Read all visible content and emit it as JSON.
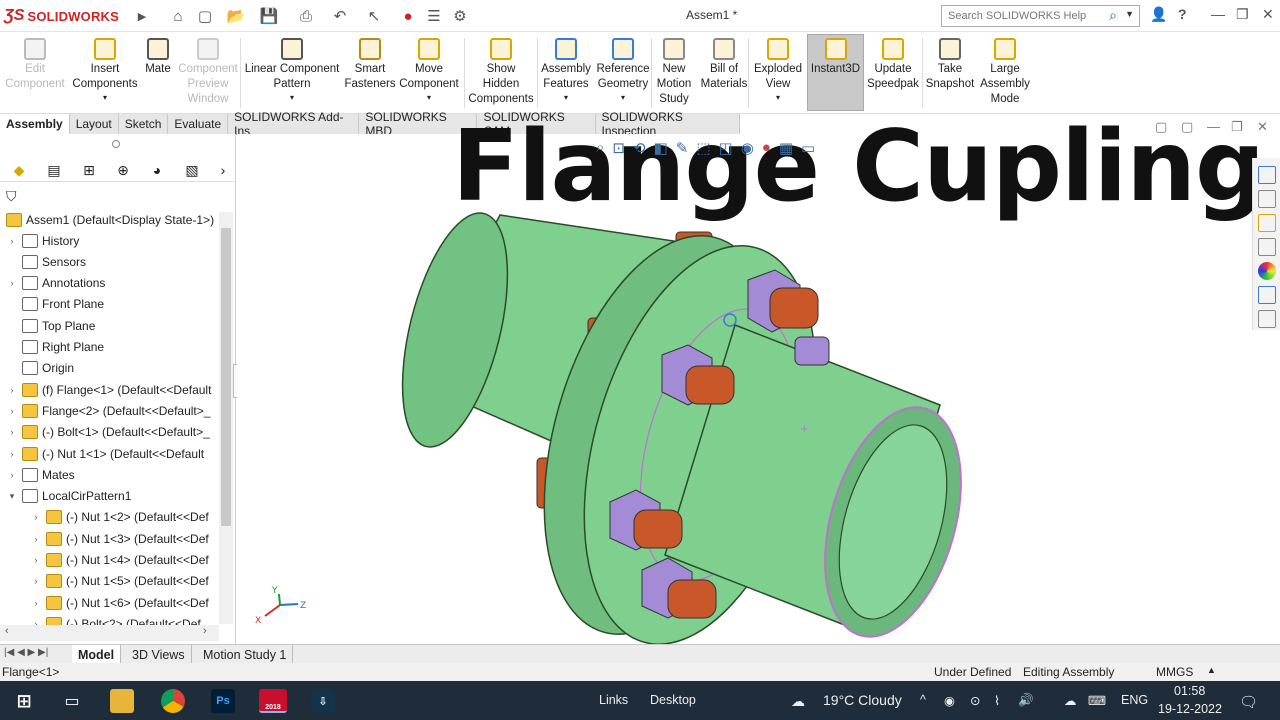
{
  "app": {
    "brand": "SOLIDWORKS",
    "doc_title": "Assem1 *"
  },
  "search": {
    "placeholder": "Search SOLIDWORKS Help"
  },
  "ribbon": {
    "buttons": [
      {
        "label": "Edit\nComponent",
        "disabled": true
      },
      {
        "label": "Insert\nComponents",
        "disabled": false
      },
      {
        "label": "Mate",
        "disabled": false
      },
      {
        "label": "Component\nPreview\nWindow",
        "disabled": true
      },
      {
        "label": "Linear Component\nPattern",
        "disabled": false
      },
      {
        "label": "Smart\nFasteners",
        "disabled": false
      },
      {
        "label": "Move\nComponent",
        "disabled": false
      },
      {
        "label": "Show\nHidden\nComponents",
        "disabled": false
      },
      {
        "label": "Assembly\nFeatures",
        "disabled": false
      },
      {
        "label": "Reference\nGeometry",
        "disabled": false
      },
      {
        "label": "New\nMotion\nStudy",
        "disabled": false
      },
      {
        "label": "Bill of\nMaterials",
        "disabled": false
      },
      {
        "label": "Exploded\nView",
        "disabled": false
      },
      {
        "label": "Instant3D",
        "disabled": false
      },
      {
        "label": "Update\nSpeedpak",
        "disabled": false
      },
      {
        "label": "Take\nSnapshot",
        "disabled": false
      },
      {
        "label": "Large\nAssembly\nMode",
        "disabled": false
      }
    ]
  },
  "command_tabs": [
    "Assembly",
    "Layout",
    "Sketch",
    "Evaluate",
    "SOLIDWORKS Add-Ins",
    "SOLIDWORKS MBD",
    "SOLIDWORKS CAM",
    "SOLIDWORKS Inspection"
  ],
  "tree": {
    "root": "Assem1  (Default<Display State-1>)",
    "items": [
      {
        "label": "History"
      },
      {
        "label": "Sensors"
      },
      {
        "label": "Annotations"
      },
      {
        "label": "Front Plane"
      },
      {
        "label": "Top Plane"
      },
      {
        "label": "Right Plane"
      },
      {
        "label": "Origin"
      },
      {
        "label": "(f) Flange<1> (Default<<Default"
      },
      {
        "label": "Flange<2> (Default<<Default>_"
      },
      {
        "label": "(-) Bolt<1> (Default<<Default>_"
      },
      {
        "label": "(-) Nut 1<1> (Default<<Default"
      },
      {
        "label": "Mates"
      },
      {
        "label": "LocalCirPattern1"
      },
      {
        "label": "(-) Nut 1<2> (Default<<Def"
      },
      {
        "label": "(-) Nut 1<3> (Default<<Def"
      },
      {
        "label": "(-) Nut 1<4> (Default<<Def"
      },
      {
        "label": "(-) Nut 1<5> (Default<<Def"
      },
      {
        "label": "(-) Nut 1<6> (Default<<Def"
      },
      {
        "label": "(-) Bolt<2> (Default<<Def"
      }
    ]
  },
  "viewport": {
    "overlay_title": "Flange Cupling",
    "triad": {
      "x": "X",
      "y": "Y",
      "z": "Z"
    }
  },
  "bottom_tabs": [
    "Model",
    "3D Views",
    "Motion Study 1"
  ],
  "status": {
    "selection": "Flange<1>",
    "state": "Under Defined",
    "mode": "Editing Assembly",
    "units": "MMGS"
  },
  "taskbar": {
    "links": "Links",
    "desktop": "Desktop",
    "weather": "19°C  Cloudy",
    "lang": "ENG",
    "time": "01:58",
    "date": "19-12-2022",
    "sw_badge": "2018"
  },
  "colors": {
    "pipe": "#7fcf8e",
    "bolt": "#c8572a",
    "nut": "#a48bd6",
    "brand_red": "#d12323",
    "taskbar": "#1f2c3a"
  }
}
